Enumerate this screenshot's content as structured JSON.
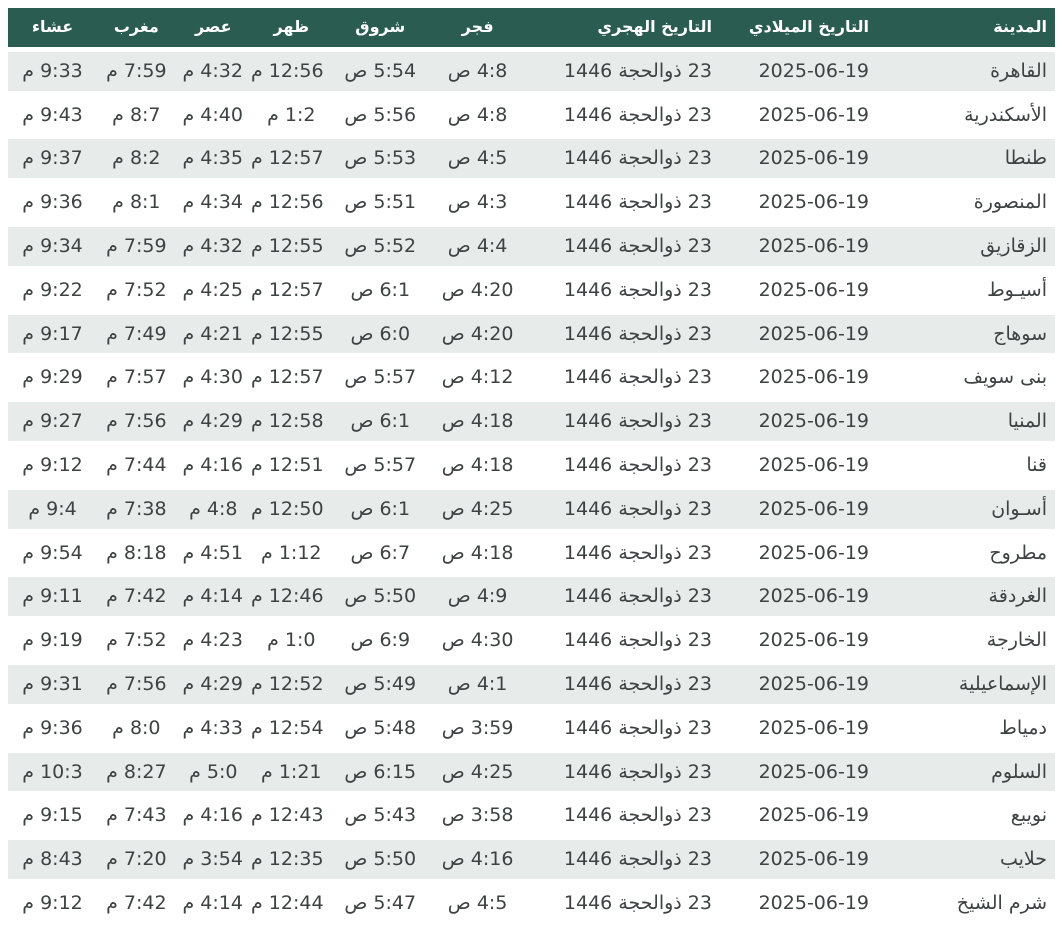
{
  "colors": {
    "header_bg": "#2a5c51",
    "header_text": "#ffffff",
    "row_alt_bg": "#e7ebea",
    "cell_text": "#3d4242"
  },
  "table": {
    "headers": [
      "المدينة",
      "التاريخ الميلادي",
      "التاريخ الهجري",
      "فجر",
      "شروق",
      "ظهر",
      "عصر",
      "مغرب",
      "عشاء"
    ],
    "rows": [
      {
        "city": "القاهرة",
        "gregorian": "2025-06-19",
        "hijri": "23 ذوالحجة 1446",
        "fajr": "4:8 ص",
        "sunrise": "5:54 ص",
        "dhuhr": "12:56 م",
        "asr": "4:32 م",
        "maghrib": "7:59 م",
        "isha": "9:33 م"
      },
      {
        "city": "الأسكندرية",
        "gregorian": "2025-06-19",
        "hijri": "23 ذوالحجة 1446",
        "fajr": "4:8 ص",
        "sunrise": "5:56 ص",
        "dhuhr": "1:2 م",
        "asr": "4:40 م",
        "maghrib": "8:7 م",
        "isha": "9:43 م"
      },
      {
        "city": "طنطا",
        "gregorian": "2025-06-19",
        "hijri": "23 ذوالحجة 1446",
        "fajr": "4:5 ص",
        "sunrise": "5:53 ص",
        "dhuhr": "12:57 م",
        "asr": "4:35 م",
        "maghrib": "8:2 م",
        "isha": "9:37 م"
      },
      {
        "city": "المنصورة",
        "gregorian": "2025-06-19",
        "hijri": "23 ذوالحجة 1446",
        "fajr": "4:3 ص",
        "sunrise": "5:51 ص",
        "dhuhr": "12:56 م",
        "asr": "4:34 م",
        "maghrib": "8:1 م",
        "isha": "9:36 م"
      },
      {
        "city": "الزقازيق",
        "gregorian": "2025-06-19",
        "hijri": "23 ذوالحجة 1446",
        "fajr": "4:4 ص",
        "sunrise": "5:52 ص",
        "dhuhr": "12:55 م",
        "asr": "4:32 م",
        "maghrib": "7:59 م",
        "isha": "9:34 م"
      },
      {
        "city": "أسيـوط",
        "gregorian": "2025-06-19",
        "hijri": "23 ذوالحجة 1446",
        "fajr": "4:20 ص",
        "sunrise": "6:1 ص",
        "dhuhr": "12:57 م",
        "asr": "4:25 م",
        "maghrib": "7:52 م",
        "isha": "9:22 م"
      },
      {
        "city": "سوهاج",
        "gregorian": "2025-06-19",
        "hijri": "23 ذوالحجة 1446",
        "fajr": "4:20 ص",
        "sunrise": "6:0 ص",
        "dhuhr": "12:55 م",
        "asr": "4:21 م",
        "maghrib": "7:49 م",
        "isha": "9:17 م"
      },
      {
        "city": "بنى سويف",
        "gregorian": "2025-06-19",
        "hijri": "23 ذوالحجة 1446",
        "fajr": "4:12 ص",
        "sunrise": "5:57 ص",
        "dhuhr": "12:57 م",
        "asr": "4:30 م",
        "maghrib": "7:57 م",
        "isha": "9:29 م"
      },
      {
        "city": "المنيا",
        "gregorian": "2025-06-19",
        "hijri": "23 ذوالحجة 1446",
        "fajr": "4:18 ص",
        "sunrise": "6:1 ص",
        "dhuhr": "12:58 م",
        "asr": "4:29 م",
        "maghrib": "7:56 م",
        "isha": "9:27 م"
      },
      {
        "city": "قنا",
        "gregorian": "2025-06-19",
        "hijri": "23 ذوالحجة 1446",
        "fajr": "4:18 ص",
        "sunrise": "5:57 ص",
        "dhuhr": "12:51 م",
        "asr": "4:16 م",
        "maghrib": "7:44 م",
        "isha": "9:12 م"
      },
      {
        "city": "أسـوان",
        "gregorian": "2025-06-19",
        "hijri": "23 ذوالحجة 1446",
        "fajr": "4:25 ص",
        "sunrise": "6:1 ص",
        "dhuhr": "12:50 م",
        "asr": "4:8 م",
        "maghrib": "7:38 م",
        "isha": "9:4 م"
      },
      {
        "city": "مطروح",
        "gregorian": "2025-06-19",
        "hijri": "23 ذوالحجة 1446",
        "fajr": "4:18 ص",
        "sunrise": "6:7 ص",
        "dhuhr": "1:12 م",
        "asr": "4:51 م",
        "maghrib": "8:18 م",
        "isha": "9:54 م"
      },
      {
        "city": "الغردقة",
        "gregorian": "2025-06-19",
        "hijri": "23 ذوالحجة 1446",
        "fajr": "4:9 ص",
        "sunrise": "5:50 ص",
        "dhuhr": "12:46 م",
        "asr": "4:14 م",
        "maghrib": "7:42 م",
        "isha": "9:11 م"
      },
      {
        "city": "الخارجة",
        "gregorian": "2025-06-19",
        "hijri": "23 ذوالحجة 1446",
        "fajr": "4:30 ص",
        "sunrise": "6:9 ص",
        "dhuhr": "1:0 م",
        "asr": "4:23 م",
        "maghrib": "7:52 م",
        "isha": "9:19 م"
      },
      {
        "city": "الإسماعيلية",
        "gregorian": "2025-06-19",
        "hijri": "23 ذوالحجة 1446",
        "fajr": "4:1 ص",
        "sunrise": "5:49 ص",
        "dhuhr": "12:52 م",
        "asr": "4:29 م",
        "maghrib": "7:56 م",
        "isha": "9:31 م"
      },
      {
        "city": "دمياط",
        "gregorian": "2025-06-19",
        "hijri": "23 ذوالحجة 1446",
        "fajr": "3:59 ص",
        "sunrise": "5:48 ص",
        "dhuhr": "12:54 م",
        "asr": "4:33 م",
        "maghrib": "8:0 م",
        "isha": "9:36 م"
      },
      {
        "city": "السلوم",
        "gregorian": "2025-06-19",
        "hijri": "23 ذوالحجة 1446",
        "fajr": "4:25 ص",
        "sunrise": "6:15 ص",
        "dhuhr": "1:21 م",
        "asr": "5:0 م",
        "maghrib": "8:27 م",
        "isha": "10:3 م"
      },
      {
        "city": "نويبع",
        "gregorian": "2025-06-19",
        "hijri": "23 ذوالحجة 1446",
        "fajr": "3:58 ص",
        "sunrise": "5:43 ص",
        "dhuhr": "12:43 م",
        "asr": "4:16 م",
        "maghrib": "7:43 م",
        "isha": "9:15 م"
      },
      {
        "city": "حلايب",
        "gregorian": "2025-06-19",
        "hijri": "23 ذوالحجة 1446",
        "fajr": "4:16 ص",
        "sunrise": "5:50 ص",
        "dhuhr": "12:35 م",
        "asr": "3:54 م",
        "maghrib": "7:20 م",
        "isha": "8:43 م"
      },
      {
        "city": "شرم الشيخ",
        "gregorian": "2025-06-19",
        "hijri": "23 ذوالحجة 1446",
        "fajr": "4:5 ص",
        "sunrise": "5:47 ص",
        "dhuhr": "12:44 م",
        "asr": "4:14 م",
        "maghrib": "7:42 م",
        "isha": "9:12 م"
      }
    ]
  }
}
